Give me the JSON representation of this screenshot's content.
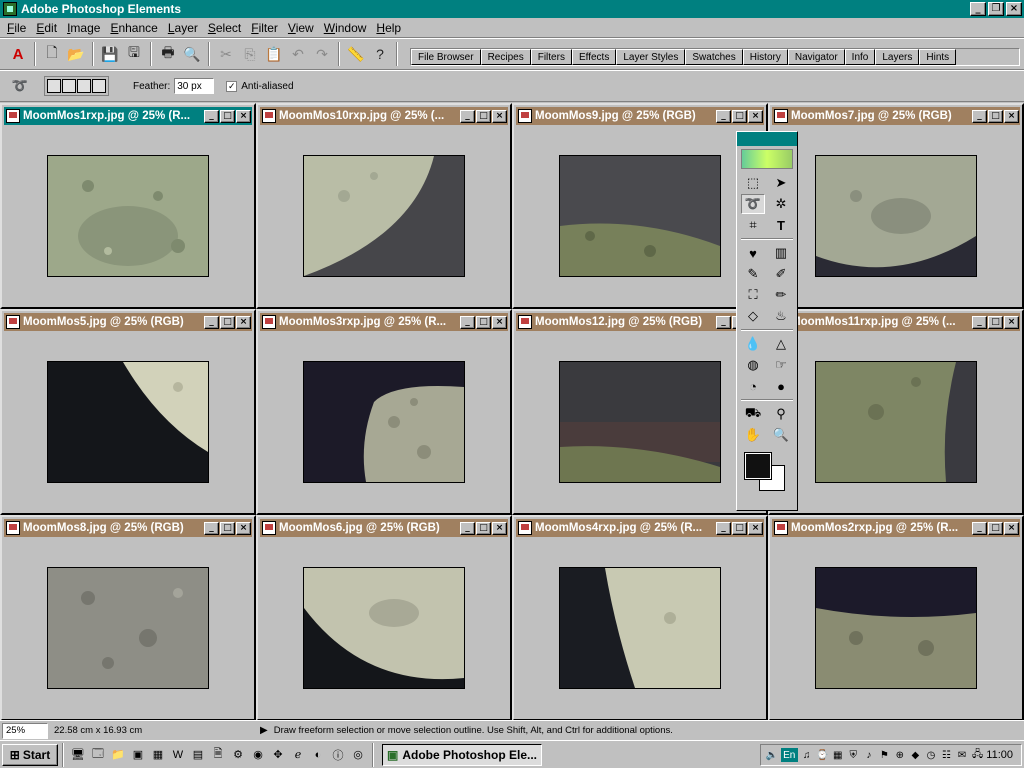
{
  "app": {
    "title": "Adobe Photoshop Elements"
  },
  "menu": [
    "File",
    "Edit",
    "Image",
    "Enhance",
    "Layer",
    "Select",
    "Filter",
    "View",
    "Window",
    "Help"
  ],
  "palette_tabs": [
    "File Browser",
    "Recipes",
    "Filters",
    "Effects",
    "Layer Styles",
    "Swatches",
    "History",
    "Navigator",
    "Info",
    "Layers",
    "Hints"
  ],
  "options": {
    "feather_label": "Feather:",
    "feather_value": "30 px",
    "anti_aliased_label": "Anti-aliased",
    "anti_aliased": true
  },
  "documents": [
    {
      "title": "MoomMos1rxp.jpg @ 25% (R...",
      "active": true
    },
    {
      "title": "MoomMos10rxp.jpg @ 25% (..."
    },
    {
      "title": "MoomMos9.jpg @ 25% (RGB)"
    },
    {
      "title": "MoomMos7.jpg @ 25% (RGB)"
    },
    {
      "title": "MoomMos5.jpg @ 25% (RGB)"
    },
    {
      "title": "MoomMos3rxp.jpg @ 25% (R..."
    },
    {
      "title": "MoomMos12.jpg @ 25% (RGB)"
    },
    {
      "title": "MoomMos11rxp.jpg @ 25% (..."
    },
    {
      "title": "MoomMos8.jpg @ 25% (RGB)"
    },
    {
      "title": "MoomMos6.jpg @ 25% (RGB)"
    },
    {
      "title": "MoomMos4rxp.jpg @ 25% (R..."
    },
    {
      "title": "MoomMos2rxp.jpg @ 25% (R..."
    }
  ],
  "status": {
    "zoom": "25%",
    "size": "22.58 cm x 16.93 cm",
    "hint": "Draw freeform selection or move selection outline.  Use Shift, Alt, and Ctrl for additional options."
  },
  "taskbar": {
    "start": "Start",
    "task": "Adobe Photoshop Ele...",
    "tray_lang": "En",
    "clock": "11:00"
  },
  "colors": {
    "active_title": "#008080",
    "inactive_title": "#a08060",
    "foreground": "#111111",
    "background": "#ffffff"
  }
}
